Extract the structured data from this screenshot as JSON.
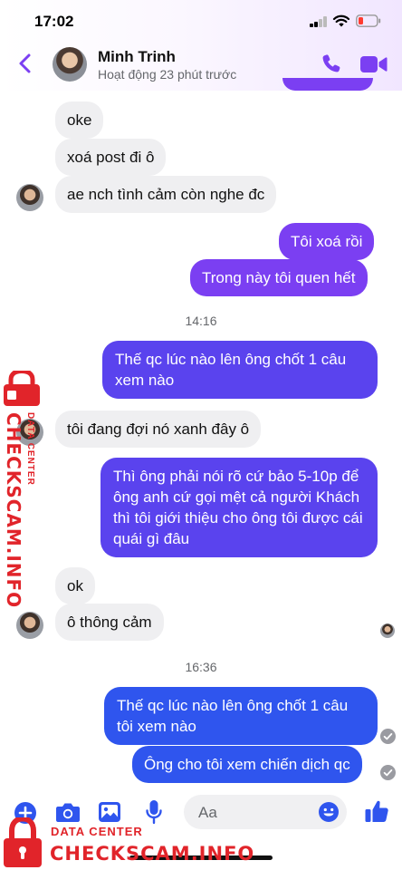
{
  "status_bar": {
    "time": "17:02"
  },
  "header": {
    "name": "Minh Trinh",
    "status": "Hoạt động 23 phút trước"
  },
  "messages": [
    {
      "text": "oke"
    },
    {
      "text": "xoá post đi ô"
    },
    {
      "text": "ae nch tình cảm còn nghe đc"
    },
    {
      "text": "Tôi xoá rồi"
    },
    {
      "text": "Trong này tôi quen hết"
    },
    {
      "text": "Thế qc lúc nào lên ông chốt 1 câu xem nào"
    },
    {
      "text": "tôi đang đợi nó xanh đây ô"
    },
    {
      "text": "Thì ông phải nói rõ cứ bảo 5-10p để ông anh cứ gọi mệt cả người Khách thì tôi giới thiệu cho ông tôi được cái quái gì đâu"
    },
    {
      "text": "ok"
    },
    {
      "text": "ô thông cảm"
    },
    {
      "text": "Thế qc lúc nào lên ông chốt 1 câu tôi xem nào"
    },
    {
      "text": "Ông cho tôi xem chiến dịch qc"
    }
  ],
  "timestamps": [
    "14:16",
    "16:36"
  ],
  "composer": {
    "placeholder": "Aa"
  },
  "watermark": {
    "brand": "CHECKSCAM.INFO",
    "sub": "DATA CENTER"
  },
  "colors": {
    "accent": "#7b3ff2",
    "violet": "#5a43ee",
    "blue": "#2f55ee",
    "incoming": "#efeff1",
    "watermark": "#e1242a"
  },
  "icons": [
    "back-icon",
    "call-icon",
    "video-icon",
    "add-icon",
    "camera-icon",
    "image-icon",
    "mic-icon",
    "emoji-icon",
    "like-icon",
    "check-icon",
    "lock-icon"
  ]
}
